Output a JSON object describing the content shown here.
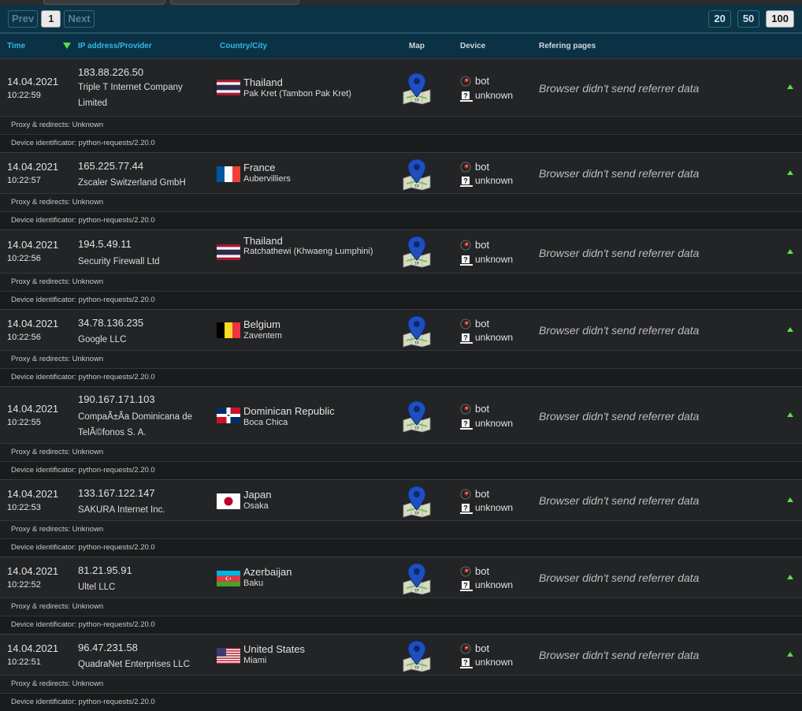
{
  "pagination": {
    "prev": "Prev",
    "current": "1",
    "next": "Next",
    "sizes": [
      "20",
      "50",
      "100"
    ],
    "active_size": "100"
  },
  "headers": {
    "time": "Time",
    "ip": "IP address/Provider",
    "country": "Country/City",
    "map": "Map",
    "device": "Device",
    "referring": "Refering pages"
  },
  "rows": [
    {
      "date": "14.04.2021",
      "time": "10:22:59",
      "ip": "183.88.226.50",
      "provider": "Triple T Internet Company Limited",
      "country": "Thailand",
      "city": "Pak Kret (Tambon Pak Kret)",
      "flag": "th",
      "device_type": "bot",
      "os": "unknown",
      "referrer": "Browser didn't send referrer data",
      "proxy": "Proxy & redirects: Unknown",
      "device_id": "Device identificator: python-requests/2.20.0"
    },
    {
      "date": "14.04.2021",
      "time": "10:22:57",
      "ip": "165.225.77.44",
      "provider": "Zscaler Switzerland GmbH",
      "country": "France",
      "city": "Aubervilliers",
      "flag": "fr",
      "device_type": "bot",
      "os": "unknown",
      "referrer": "Browser didn't send referrer data",
      "proxy": "Proxy & redirects: Unknown",
      "device_id": "Device identificator: python-requests/2.20.0"
    },
    {
      "date": "14.04.2021",
      "time": "10:22:56",
      "ip": "194.5.49.11",
      "provider": "Security Firewall Ltd",
      "country": "Thailand",
      "city": "Ratchathewi (Khwaeng Lumphini)",
      "flag": "th",
      "device_type": "bot",
      "os": "unknown",
      "referrer": "Browser didn't send referrer data",
      "proxy": "Proxy & redirects: Unknown",
      "device_id": "Device identificator: python-requests/2.20.0"
    },
    {
      "date": "14.04.2021",
      "time": "10:22:56",
      "ip": "34.78.136.235",
      "provider": "Google LLC",
      "country": "Belgium",
      "city": "Zaventem",
      "flag": "be",
      "device_type": "bot",
      "os": "unknown",
      "referrer": "Browser didn't send referrer data",
      "proxy": "Proxy & redirects: Unknown",
      "device_id": "Device identificator: python-requests/2.20.0"
    },
    {
      "date": "14.04.2021",
      "time": "10:22:55",
      "ip": "190.167.171.103",
      "provider": "CompaÃ±Ã­a Dominicana de TelÃ©fonos S. A.",
      "country": "Dominican Republic",
      "city": "Boca Chica",
      "flag": "do",
      "device_type": "bot",
      "os": "unknown",
      "referrer": "Browser didn't send referrer data",
      "proxy": "Proxy & redirects: Unknown",
      "device_id": "Device identificator: python-requests/2.20.0"
    },
    {
      "date": "14.04.2021",
      "time": "10:22:53",
      "ip": "133.167.122.147",
      "provider": "SAKURA Internet Inc.",
      "country": "Japan",
      "city": "Osaka",
      "flag": "jp",
      "device_type": "bot",
      "os": "unknown",
      "referrer": "Browser didn't send referrer data",
      "proxy": "Proxy & redirects: Unknown",
      "device_id": "Device identificator: python-requests/2.20.0"
    },
    {
      "date": "14.04.2021",
      "time": "10:22:52",
      "ip": "81.21.95.91",
      "provider": "Ultel LLC",
      "country": "Azerbaijan",
      "city": "Baku",
      "flag": "az",
      "device_type": "bot",
      "os": "unknown",
      "referrer": "Browser didn't send referrer data",
      "proxy": "Proxy & redirects: Unknown",
      "device_id": "Device identificator: python-requests/2.20.0"
    },
    {
      "date": "14.04.2021",
      "time": "10:22:51",
      "ip": "96.47.231.58",
      "provider": "QuadraNet Enterprises LLC",
      "country": "United States",
      "city": "Miami",
      "flag": "us",
      "device_type": "bot",
      "os": "unknown",
      "referrer": "Browser didn't send referrer data",
      "proxy": "Proxy & redirects: Unknown",
      "device_id": "Device identificator: python-requests/2.20.0"
    }
  ]
}
